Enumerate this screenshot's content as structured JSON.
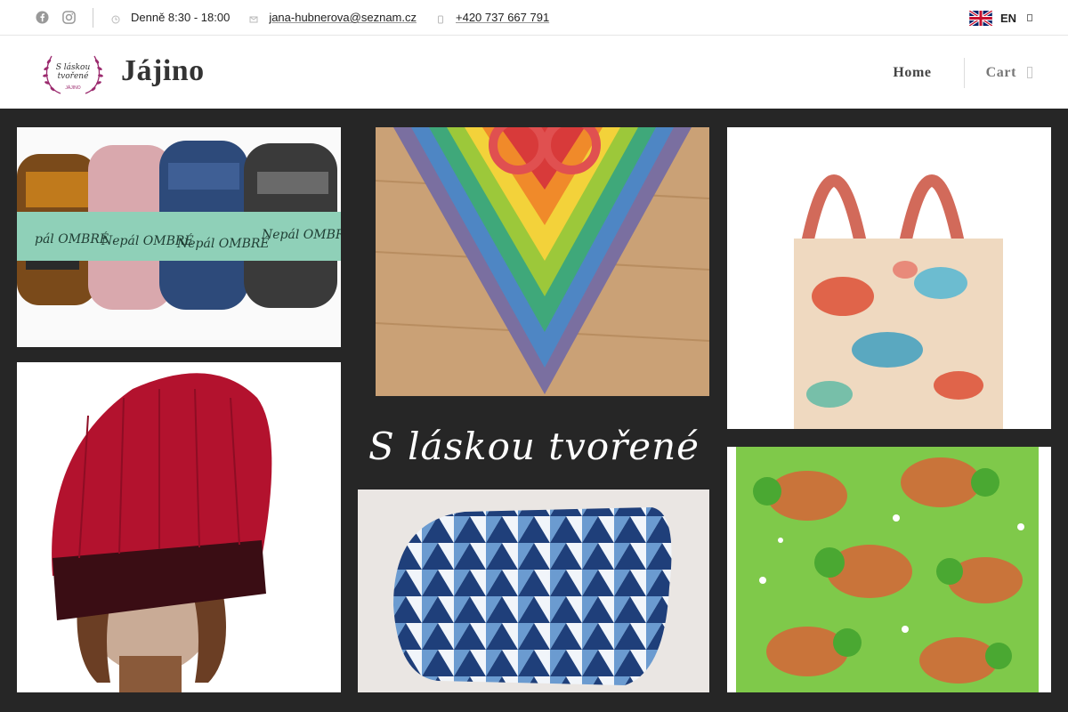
{
  "topbar": {
    "social": [
      {
        "name": "facebook-icon"
      },
      {
        "name": "instagram-icon"
      }
    ],
    "hours": "Denně 8:30 - 18:00",
    "email": "jana-hubnerova@seznam.cz",
    "phone": "+420 737 667 791",
    "language": "EN"
  },
  "header": {
    "logo_text_line1": "S láskou",
    "logo_text_line2": "tvořené",
    "logo_text_line3": "JÁJINO",
    "brand": "Jájino",
    "nav": {
      "home": "Home",
      "cart": "Cart"
    }
  },
  "hero": {
    "title": "S láskou tvořené",
    "tiles": [
      "yarn-skeins",
      "rainbow-shawl",
      "paisley-tote-bag",
      "knitted-beanie",
      "triangle-pillow",
      "turtle-pillow"
    ]
  },
  "colors": {
    "hero_bg": "#262626",
    "text": "#222222",
    "accent": "#9b2a6e"
  }
}
